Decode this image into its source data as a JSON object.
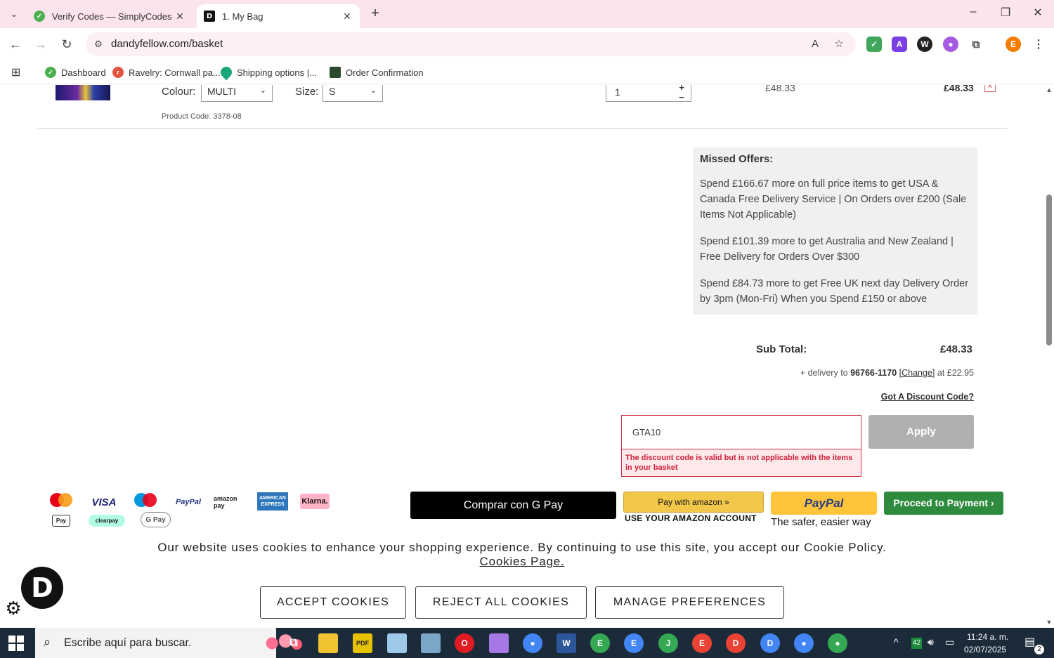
{
  "browser": {
    "tabs": [
      {
        "title": "Verify Codes — SimplyCodes",
        "active": false
      },
      {
        "title": "1. My Bag",
        "active": true
      }
    ],
    "url": "dandyfellow.com/basket",
    "bookmarks": [
      {
        "label": "Dashboard"
      },
      {
        "label": "Ravelry: Cornwall pa..."
      },
      {
        "label": "Shipping options |..."
      },
      {
        "label": "Order Confirmation"
      }
    ],
    "profile_initial": "E"
  },
  "basket_row": {
    "colour_label": "Colour:",
    "colour_value": "MULTI",
    "size_label": "Size:",
    "size_value": "S",
    "product_code": "Product Code: 3378-08",
    "quantity": "1",
    "unit_price": "£48.33",
    "line_total": "£48.33"
  },
  "missed_offers": {
    "heading": "Missed Offers:",
    "items": [
      "Spend £166.67 more on full price items to get USA & Canada Free Delivery Service | On Orders over £200 (Sale Items Not Applicable)",
      "Spend £101.39 more to get Australia and New Zealand | Free Delivery for Orders Over $300",
      "Spend £84.73 more to get Free UK next day Delivery Order by 3pm (Mon-Fri) When you Spend £150 or above"
    ]
  },
  "summary": {
    "subtotal_label": "Sub Total:",
    "subtotal_value": "£48.33",
    "delivery_prefix": "+ delivery to",
    "delivery_zip": "96766-1170",
    "delivery_change": "[Change]",
    "delivery_suffix": "at £22.95",
    "discount_link": "Got A Discount Code?"
  },
  "discount": {
    "code_value": "GTA10",
    "error": "The discount code is valid but is not applicable with the items in your basket",
    "apply_label": "Apply"
  },
  "payment_logos": [
    "mastercard",
    "VISA",
    "maestro",
    "PayPal",
    "amazon pay",
    "AMERICAN EXPRESS",
    "Klarna.",
    "Pay",
    "clearpay",
    "G Pay"
  ],
  "checkout": {
    "gpay_label": "Comprar con G Pay",
    "amazon_label": "Pay with amazon »",
    "amazon_sub": "USE YOUR AMAZON ACCOUNT",
    "paypal_label": "PayPal",
    "paypal_sub": "The safer, easier way",
    "proceed_label": "Proceed to Payment ›"
  },
  "cookie_banner": {
    "message": "Our website uses cookies to enhance your shopping experience. By continuing to use this site, you accept our Cookie Policy.",
    "link": "Cookies Page.",
    "accept": "ACCEPT COOKIES",
    "reject": "REJECT ALL COOKIES",
    "manage": "MANAGE PREFERENCES",
    "badge_letter": "D"
  },
  "taskbar": {
    "search_placeholder": "Escribe aquí para buscar.",
    "time": "11:24 a. m.",
    "date": "02/07/2025",
    "temp": "42",
    "notifications": "2"
  },
  "colors": {
    "proceed": "#2e8b3e",
    "error": "#d0223a",
    "tabstrip": "#fce4ec",
    "taskbar": "#1c2b3a"
  }
}
